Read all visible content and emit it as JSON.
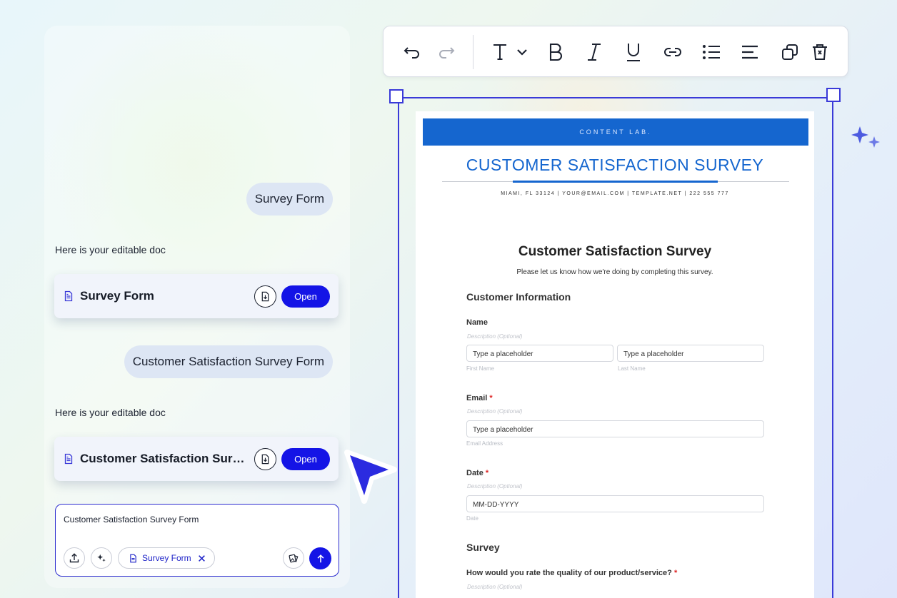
{
  "chat": {
    "messages": [
      {
        "user_text": "Survey Form",
        "reply_text": "Here is your editable doc",
        "doc_title": "Survey Form",
        "open_label": "Open"
      },
      {
        "user_text": "Customer Satisfaction Survey Form",
        "reply_text": "Here is your editable doc",
        "doc_title": "Customer Satisfaction Survey Form",
        "open_label": "Open"
      }
    ],
    "composer": {
      "text": "Customer Satisfaction Survey Form",
      "chip_label": "Survey Form"
    }
  },
  "toolbar": {
    "tools": [
      "undo-icon",
      "redo-icon",
      "text-style-icon",
      "bold-icon",
      "italic-icon",
      "underline-icon",
      "link-icon",
      "bullet-list-icon",
      "align-left-icon",
      "duplicate-icon",
      "delete-icon"
    ]
  },
  "document": {
    "banner": "CONTENT LAB.",
    "title": "CUSTOMER SATISFACTION SURVEY",
    "address": "MIAMI, FL 33124 | YOUR@EMAIL.COM | TEMPLATE.NET | 222 555 777",
    "form_title": "Customer Satisfaction Survey",
    "form_subtitle": "Please let us know how we're doing by completing this survey.",
    "section_customer": "Customer Information",
    "name_label": "Name",
    "desc_optional": "Description (Optional)",
    "placeholder": "Type a placeholder",
    "first_name": "First Name",
    "last_name": "Last Name",
    "email_label": "Email",
    "required_mark": "*",
    "email_caption": "Email Address",
    "date_label": "Date",
    "date_placeholder": "MM-DD-YYYY",
    "date_caption": "Date",
    "section_survey": "Survey",
    "question_1": "How would you rate the quality of our product/service?"
  },
  "colors": {
    "accent": "#1414e6",
    "doc_blue": "#1566cf",
    "selection": "#3a3ad8"
  }
}
